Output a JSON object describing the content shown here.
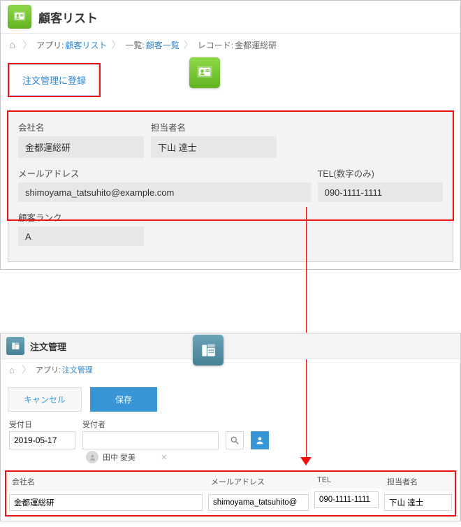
{
  "top": {
    "appTitle": "顧客リスト",
    "breadcrumb": {
      "appPrefix": "アプリ: ",
      "appLink": "顧客リスト",
      "listPrefix": "一覧: ",
      "listLink": "顧客一覧",
      "recordPrefix": "レコード: ",
      "recordText": "金都運総研"
    },
    "registerBtn": "注文管理に登録",
    "fields": {
      "companyLabel": "会社名",
      "companyValue": "金都運総研",
      "contactLabel": "担当者名",
      "contactValue": "下山 達士",
      "emailLabel": "メールアドレス",
      "emailValue": "shimoyama_tatsuhito@example.com",
      "telLabel": "TEL(数字のみ)",
      "telValue": "090-1111-1111",
      "rankLabel": "顧客ランク",
      "rankValue": "A"
    }
  },
  "bottom": {
    "appTitle": "注文管理",
    "breadcrumb": {
      "appPrefix": "アプリ: ",
      "appLink": "注文管理"
    },
    "cancel": "キャンセル",
    "save": "保存",
    "form": {
      "dateLabel": "受付日",
      "dateValue": "2019-05-17",
      "recvLabel": "受付者",
      "recvValue": "",
      "chipName": "田中 愛美"
    },
    "cols": {
      "companyLabel": "会社名",
      "companyValue": "金都運総研",
      "emailLabel": "メールアドレス",
      "emailValue": "shimoyama_tatsuhito@",
      "telLabel": "TEL",
      "telValue": "090-1111-1111",
      "contactLabel": "担当者名",
      "contactValue": "下山 達士"
    }
  }
}
